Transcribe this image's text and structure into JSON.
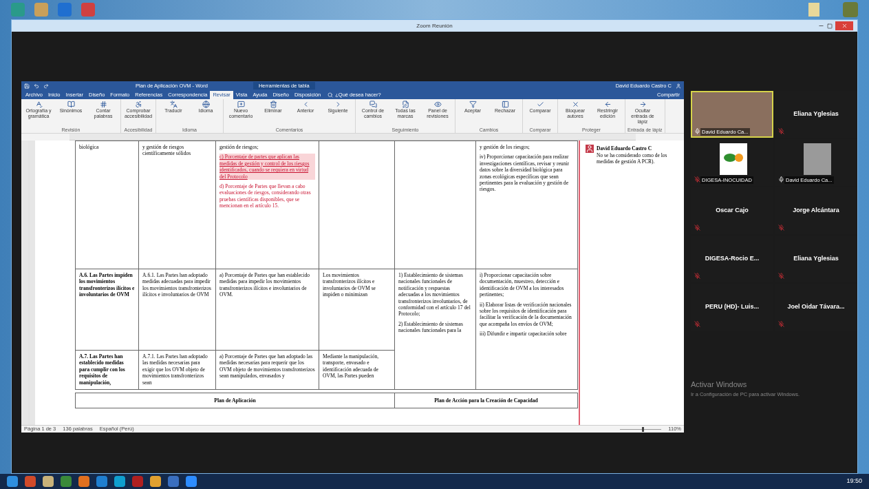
{
  "zoom_window": {
    "title": "Zoom Reunión"
  },
  "word": {
    "title": "Plan de Aplicación OVM - Word",
    "context_tab": "Herramientas de tabla",
    "user": "David Eduardo Castro C",
    "share": "Compartir",
    "tell_me": "¿Qué desea hacer?",
    "tabs": [
      {
        "label": "Archivo",
        "selected": false
      },
      {
        "label": "Inicio",
        "selected": false
      },
      {
        "label": "Insertar",
        "selected": false
      },
      {
        "label": "Diseño",
        "selected": false
      },
      {
        "label": "Formato",
        "selected": false
      },
      {
        "label": "Referencias",
        "selected": false
      },
      {
        "label": "Correspondencia",
        "selected": false
      },
      {
        "label": "Revisar",
        "selected": true
      },
      {
        "label": "Vista",
        "selected": false
      },
      {
        "label": "Ayuda",
        "selected": false
      },
      {
        "label": "Diseño",
        "selected": false
      },
      {
        "label": "Disposición",
        "selected": false
      }
    ],
    "ribbon_groups": [
      {
        "label": "Revisión",
        "buttons": [
          "Ortografía y gramática",
          "Sinónimos",
          "Contar palabras"
        ]
      },
      {
        "label": "Accesibilidad",
        "buttons": [
          "Comprobar accesibilidad"
        ]
      },
      {
        "label": "Idioma",
        "buttons": [
          "Traducir",
          "Idioma"
        ]
      },
      {
        "label": "Comentarios",
        "buttons": [
          "Nuevo comentario",
          "Eliminar",
          "Anterior",
          "Siguiente"
        ]
      },
      {
        "label": "Seguimiento",
        "buttons": [
          "Control de cambios",
          "Todas las marcas",
          "Panel de revisiones"
        ]
      },
      {
        "label": "Cambios",
        "buttons": [
          "Aceptar",
          "Rechazar"
        ]
      },
      {
        "label": "Comparar",
        "buttons": [
          "Comparar"
        ]
      },
      {
        "label": "Proteger",
        "buttons": [
          "Bloquear autores",
          "Restringir edición"
        ]
      },
      {
        "label": "Entrada de lápiz",
        "buttons": [
          "Ocultar entrada de lápiz"
        ]
      }
    ],
    "table": {
      "rows": [
        {
          "cells": [
            {
              "paragraphs": [
                {
                  "text": "biológica",
                  "tracked": false,
                  "highlighted": false
                }
              ]
            },
            {
              "paragraphs": [
                {
                  "text": "y gestión de riesgos científicamente sólidos",
                  "tracked": false,
                  "highlighted": false
                }
              ]
            },
            {
              "paragraphs": [
                {
                  "text": "gestión de riesgos;",
                  "tracked": false,
                  "highlighted": false
                },
                {
                  "text": "c) Porcentaje de partes que aplican las medidas de gestión y control de los riesgos identificados, cuando se requiera en virtud del Protocolo",
                  "tracked": true,
                  "highlighted": true
                },
                {
                  "text": "d) Porcentaje de Partes que llevan a cabo evaluaciones de riesgos, considerando otras pruebas científicas disponibles, que se mencionan en el artículo 15.",
                  "tracked": true,
                  "highlighted": false
                }
              ]
            },
            {},
            {},
            {
              "paragraphs": [
                {
                  "text": "y gestión de los riesgos;",
                  "tracked": false,
                  "highlighted": false
                },
                {
                  "text": "iv) Proporcionar capacitación para realizar investigaciones científicas, revisar y reunir datos sobre la diversidad biológica para zonas ecológicas específicas que sean pertinentes para la evaluación y gestión de riesgos.",
                  "tracked": false,
                  "highlighted": false
                }
              ]
            }
          ]
        },
        {
          "cells": [
            {
              "paragraphs": [
                {
                  "text": "A.6. Las Partes impiden los movimientos transfronterizos ilícitos e involuntarios de OVM",
                  "tracked": false,
                  "highlighted": false
                }
              ]
            },
            {
              "paragraphs": [
                {
                  "text": "A.6.1. Las Partes han adoptado medidas adecuadas para impedir los movimientos transfronterizos ilícitos e involuntarios de OVM",
                  "tracked": false,
                  "highlighted": false
                }
              ]
            },
            {
              "paragraphs": [
                {
                  "text": "a) Porcentaje de Partes que han establecido medidas para impedir los movimientos transfronterizos ilícitos e involuntarios de OVM.",
                  "tracked": false,
                  "highlighted": false
                }
              ]
            },
            {
              "paragraphs": [
                {
                  "text": "Los movimientos transfronterizos ilícitos e involuntarios de OVM se impiden o minimizan",
                  "tracked": false,
                  "highlighted": false
                }
              ]
            },
            {
              "rowspan": 2,
              "paragraphs": [
                {
                  "text": "1) Establecimiento de sistemas nacionales funcionales de notificación y respuestas adecuadas a los movimientos transfronterizos involuntarios, de conformidad con el artículo 17 del Protocolo;",
                  "tracked": false,
                  "highlighted": false
                },
                {
                  "text": "2) Establecimiento de sistemas nacionales funcionales para la",
                  "tracked": false,
                  "highlighted": false
                }
              ]
            },
            {
              "rowspan": 2,
              "paragraphs": [
                {
                  "text": "i) Proporcionar capacitación sobre documentación, muestreo, detección e identificación de OVM a los interesados pertinentes;",
                  "tracked": false,
                  "highlighted": false
                },
                {
                  "text": "ii) Elaborar listas de verificación nacionales sobre los requisitos de identificación para facilitar la verificación de la documentación que acompaña los envíos de OVM;",
                  "tracked": false,
                  "highlighted": false
                },
                {
                  "text": "iii) Difundir e impartir capacitación sobre",
                  "tracked": false,
                  "highlighted": false
                }
              ]
            }
          ]
        },
        {
          "cells": [
            {
              "paragraphs": [
                {
                  "text": "A.7. Las Partes han establecido medidas para cumplir con los requisitos de manipulación,",
                  "tracked": false,
                  "highlighted": false
                }
              ]
            },
            {
              "paragraphs": [
                {
                  "text": "A.7.1. Las Partes han adoptado las medidas necesarias para exigir que los OVM objeto de movimientos transfronterizos sean",
                  "tracked": false,
                  "highlighted": false
                }
              ]
            },
            {
              "paragraphs": [
                {
                  "text": "a) Porcentaje de Partes que han adoptado las medidas necesarias para requerir que los OVM objeto de movimientos transfronterizos sean manipulados, envasados y",
                  "tracked": false,
                  "highlighted": false
                }
              ]
            },
            {
              "paragraphs": [
                {
                  "text": "Mediante la manipulación, transporte, envasado e identificación adecuada de OVM, las Partes pueden",
                  "tracked": false,
                  "highlighted": false
                }
              ]
            }
          ]
        }
      ],
      "footer_headers": [
        "Plan de Aplicación",
        "Plan de Acción para la Creación de Capacidad"
      ]
    },
    "comment": {
      "author": "David Eduardo Castro C",
      "text": "No se ha considerado como de los medidas de gestión A PCR)."
    },
    "status_bar": {
      "page": "Página 1 de 3",
      "words": "136 palabras",
      "language": "Español (Perú)",
      "zoom": "110%",
      "level": 0.55
    }
  },
  "participants": [
    {
      "name": "David Eduardo Ca...",
      "kind": "video",
      "muted": false,
      "active": true
    },
    {
      "name": "Eliana Yglesias",
      "kind": "name",
      "muted": true,
      "active": false
    },
    {
      "name": "DIGESA-INOCUIDAD",
      "kind": "logo",
      "muted": true,
      "active": false
    },
    {
      "name": "David Eduardo Ca...",
      "kind": "photo",
      "muted": false,
      "active": false
    },
    {
      "name": "Oscar Cajo",
      "kind": "name",
      "muted": true,
      "active": false
    },
    {
      "name": "Jorge Alcántara",
      "kind": "name",
      "muted": true,
      "active": false
    },
    {
      "name": "DIGESA-Rocio E...",
      "kind": "name",
      "muted": true,
      "active": false
    },
    {
      "name": "Eliana Yglesias",
      "kind": "name",
      "muted": true,
      "active": false
    },
    {
      "name": "PERU (HD)- Luis...",
      "kind": "name",
      "muted": true,
      "active": false
    },
    {
      "name": "Joel Oidar Távara...",
      "kind": "name",
      "muted": true,
      "active": false
    }
  ],
  "activation": {
    "title": "Activar Windows",
    "text": "Ir a Configuración de PC para activar Windows."
  },
  "taskbar": {
    "clock": "19:50"
  }
}
